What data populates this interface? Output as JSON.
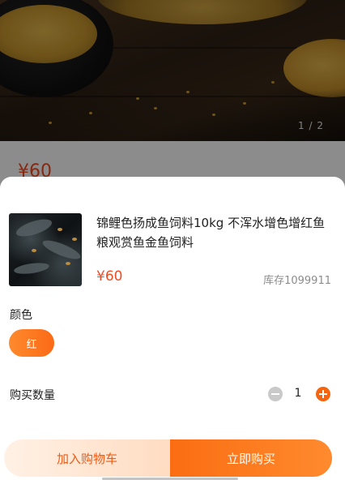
{
  "gallery": {
    "counter": "1 / 2"
  },
  "background_page": {
    "price": "¥60"
  },
  "sku_sheet": {
    "product_title": "锦鲤色扬成鱼饲料10kg 不浑水增色增红鱼粮观赏鱼金鱼饲料",
    "price": "¥60",
    "stock": "库存1099911",
    "color_label": "颜色",
    "color_options": [
      "红"
    ],
    "selected_color": "红",
    "quantity_label": "购买数量",
    "quantity": "1"
  },
  "footer": {
    "add_to_cart_label": "加入购物车",
    "buy_now_label": "立即购买"
  },
  "colors": {
    "accent": "#f5640f",
    "price": "#f04c24",
    "cart_bg": "#ffe6d3"
  }
}
